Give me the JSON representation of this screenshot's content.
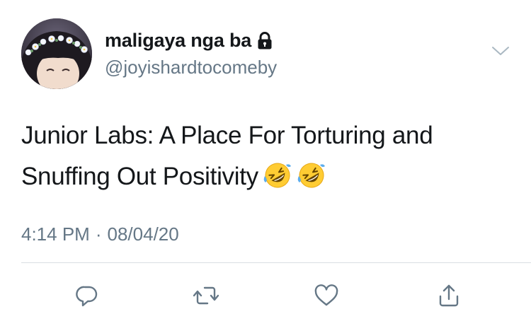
{
  "user": {
    "display_name": "maligaya nga ba",
    "handle": "@joyishardtocomeby",
    "protected_icon": "lock-icon",
    "avatar": "avatar"
  },
  "menu_icon": "chevron-down-icon",
  "tweet": {
    "text": "Junior Labs: A Place For Torturing and Snuffing Out Positivity",
    "emojis": [
      "rolling-on-floor-laughing-emoji",
      "rolling-on-floor-laughing-emoji"
    ]
  },
  "meta": {
    "time": "4:14 PM",
    "separator": "·",
    "date": "08/04/20"
  },
  "actions": [
    {
      "name": "reply",
      "icon": "reply-icon"
    },
    {
      "name": "retweet",
      "icon": "retweet-icon"
    },
    {
      "name": "like",
      "icon": "heart-icon"
    },
    {
      "name": "share",
      "icon": "share-icon"
    }
  ],
  "colors": {
    "text": "#14171a",
    "secondary": "#657786",
    "divider": "#d9dee3"
  }
}
